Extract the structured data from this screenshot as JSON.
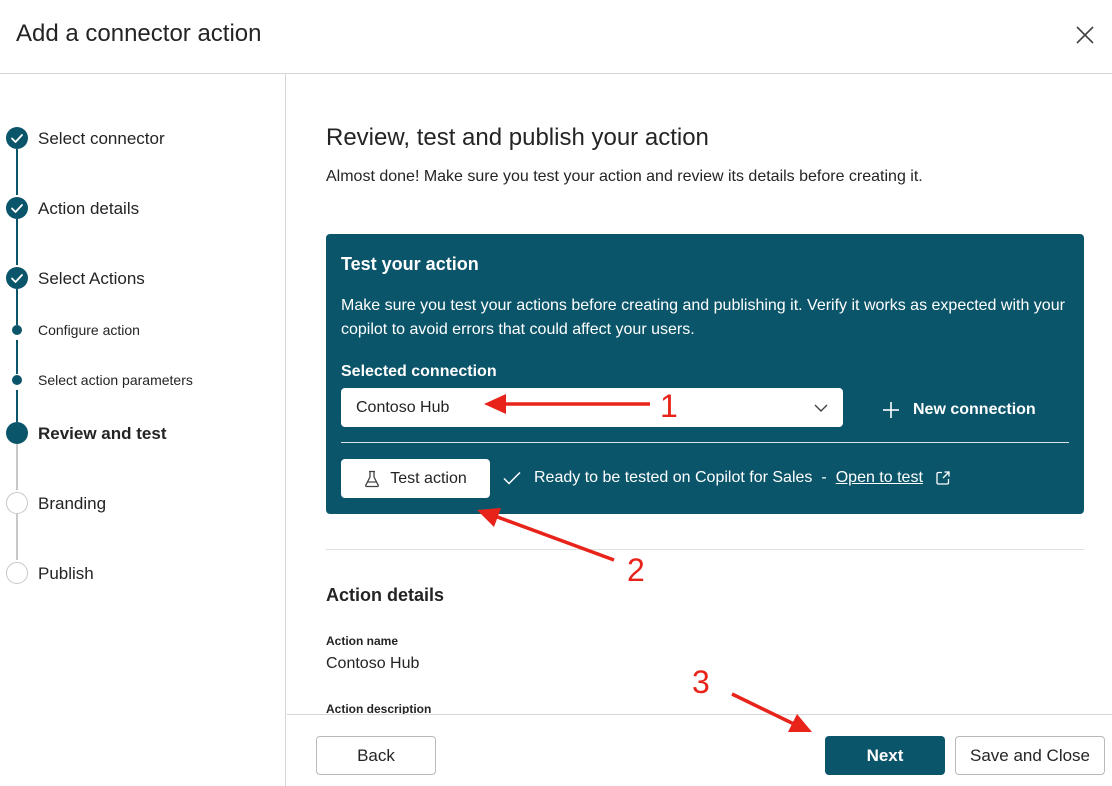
{
  "header": {
    "title": "Add a connector action",
    "close_icon": "close-icon"
  },
  "steps": [
    {
      "label": "Select connector",
      "state": "done"
    },
    {
      "label": "Action details",
      "state": "done"
    },
    {
      "label": "Select Actions",
      "state": "done"
    },
    {
      "label": "Configure action",
      "state": "substep"
    },
    {
      "label": "Select action parameters",
      "state": "substep"
    },
    {
      "label": "Review and test",
      "state": "current"
    },
    {
      "label": "Branding",
      "state": "pending"
    },
    {
      "label": "Publish",
      "state": "pending"
    }
  ],
  "main": {
    "title": "Review, test and publish your action",
    "subtitle": "Almost done! Make sure you test your action and review its details before creating it."
  },
  "test_card": {
    "title": "Test your action",
    "description": "Make sure you test your actions before creating and publishing it. Verify it works as expected with your copilot to avoid errors that could affect your users.",
    "connection_label": "Selected connection",
    "connection_value": "Contoso Hub",
    "new_connection_label": "New connection",
    "test_button_label": "Test action",
    "ready_text": "Ready to be tested on Copilot for Sales",
    "separator": "-",
    "open_link": "Open to test"
  },
  "details": {
    "title": "Action details",
    "action_name_label": "Action name",
    "action_name_value": "Contoso Hub",
    "action_description_label": "Action description"
  },
  "footer": {
    "back_label": "Back",
    "next_label": "Next",
    "save_close_label": "Save and Close"
  },
  "annotations": {
    "one": "1",
    "two": "2",
    "three": "3",
    "color": "#e8231a"
  },
  "colors": {
    "brand": "#0b556a",
    "border": "#d6d6d6"
  }
}
